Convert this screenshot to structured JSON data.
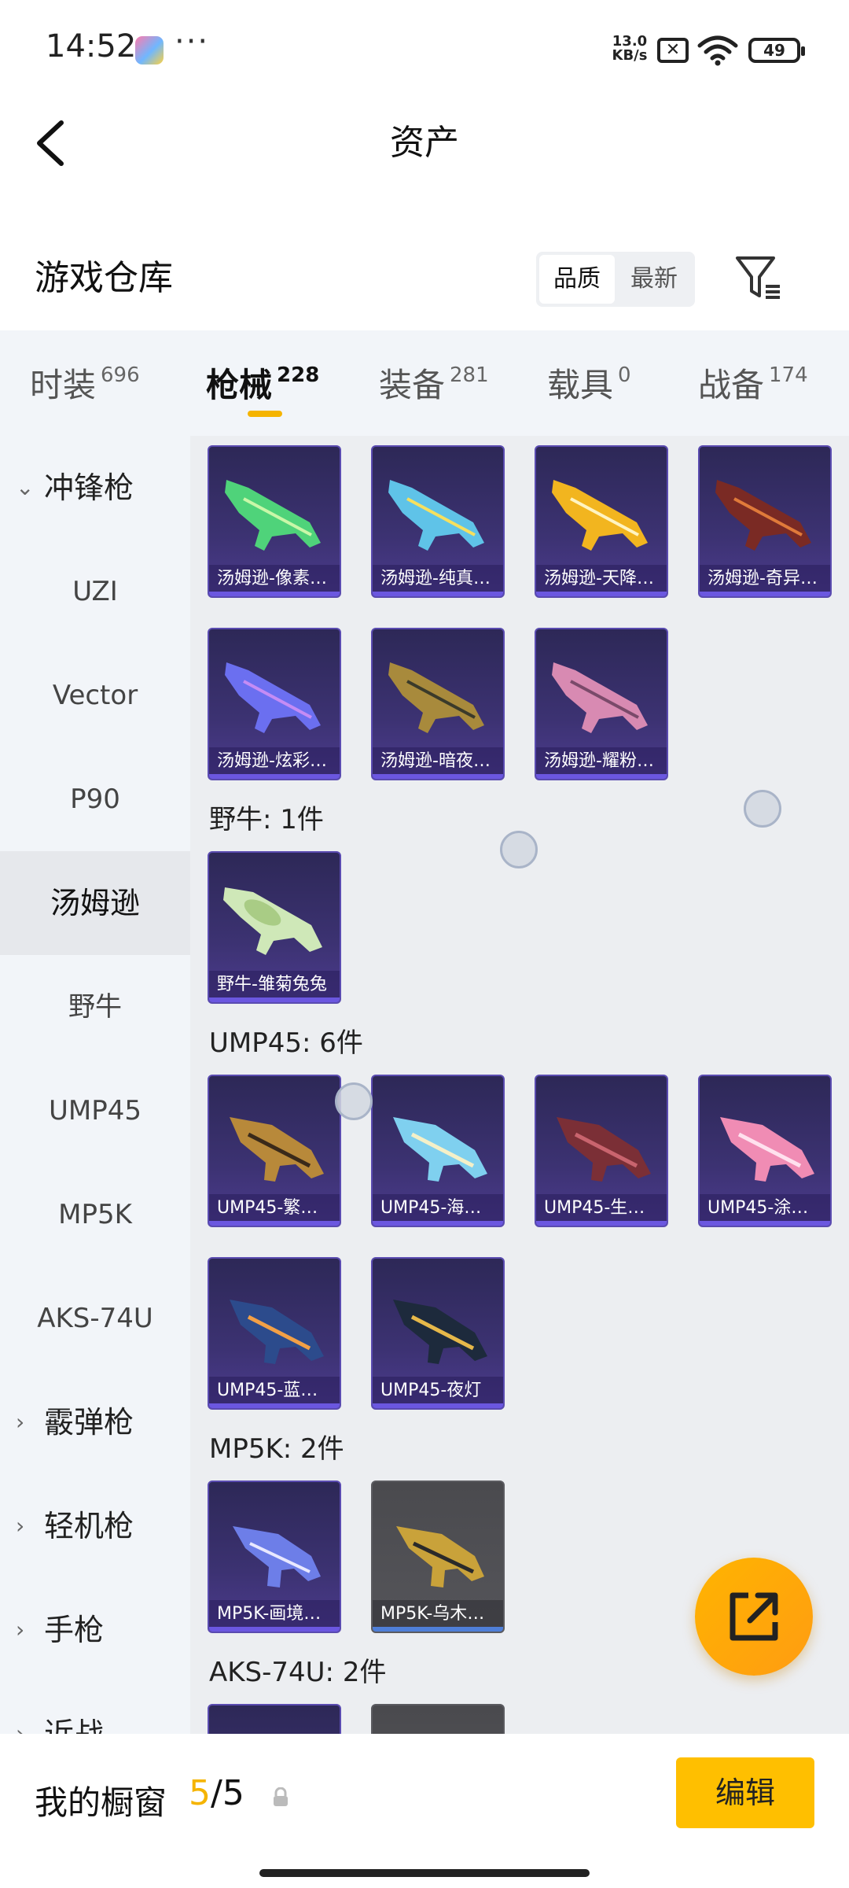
{
  "status_bar": {
    "time": "14:52",
    "dots": "···",
    "net_speed_value": "13.0",
    "net_speed_unit": "KB/s",
    "battery": "49"
  },
  "header": {
    "title": "资产"
  },
  "warehouse": {
    "title": "游戏仓库",
    "sort_options": [
      "品质",
      "最新"
    ],
    "selected_sort": "品质"
  },
  "tabs": [
    {
      "label": "时装",
      "count": "696"
    },
    {
      "label": "枪械",
      "count": "228"
    },
    {
      "label": "装备",
      "count": "281"
    },
    {
      "label": "载具",
      "count": "0"
    },
    {
      "label": "战备",
      "count": "174"
    }
  ],
  "active_tab": "枪械",
  "sidebar": {
    "items": [
      {
        "label": "冲锋枪",
        "type": "group",
        "expanded": true
      },
      {
        "label": "UZI"
      },
      {
        "label": "Vector"
      },
      {
        "label": "P90"
      },
      {
        "label": "汤姆逊",
        "active": true
      },
      {
        "label": "野牛"
      },
      {
        "label": "UMP45"
      },
      {
        "label": "MP5K"
      },
      {
        "label": "AKS-74U"
      },
      {
        "label": "霰弹枪",
        "type": "group"
      },
      {
        "label": "轻机枪",
        "type": "group"
      },
      {
        "label": "手枪",
        "type": "group"
      },
      {
        "label": "近战",
        "type": "group"
      }
    ]
  },
  "sections": [
    {
      "title": "",
      "items": [
        "汤姆逊-像素…",
        "汤姆逊-纯真…",
        "汤姆逊-天降…",
        "汤姆逊-奇异…",
        "汤姆逊-炫彩…",
        "汤姆逊-暗夜…",
        "汤姆逊-耀粉…"
      ]
    },
    {
      "title": "野牛: 1件",
      "items": [
        "野牛-雏菊兔兔"
      ]
    },
    {
      "title": "UMP45: 6件",
      "items": [
        "UMP45-繁…",
        "UMP45-海…",
        "UMP45-生…",
        "UMP45-涂…",
        "UMP45-蓝…",
        "UMP45-夜灯"
      ]
    },
    {
      "title": "MP5K: 2件",
      "items": [
        "MP5K-画境…",
        "MP5K-乌木…"
      ]
    },
    {
      "title": "AKS-74U: 2件",
      "items": [
        "",
        ""
      ]
    }
  ],
  "bottom_bar": {
    "label": "我的橱窗",
    "current": "5",
    "separator": "/",
    "total": "5",
    "edit_button": "编辑"
  },
  "colors": {
    "accent": "#f5b400",
    "card_bg": "#3c3272",
    "card_grey": "#55555a",
    "fab": "#ffac0a"
  },
  "icons": {
    "back": "back-arrow-icon",
    "filter": "filter-icon",
    "fab": "share-export-icon",
    "lock": "lock-icon"
  }
}
